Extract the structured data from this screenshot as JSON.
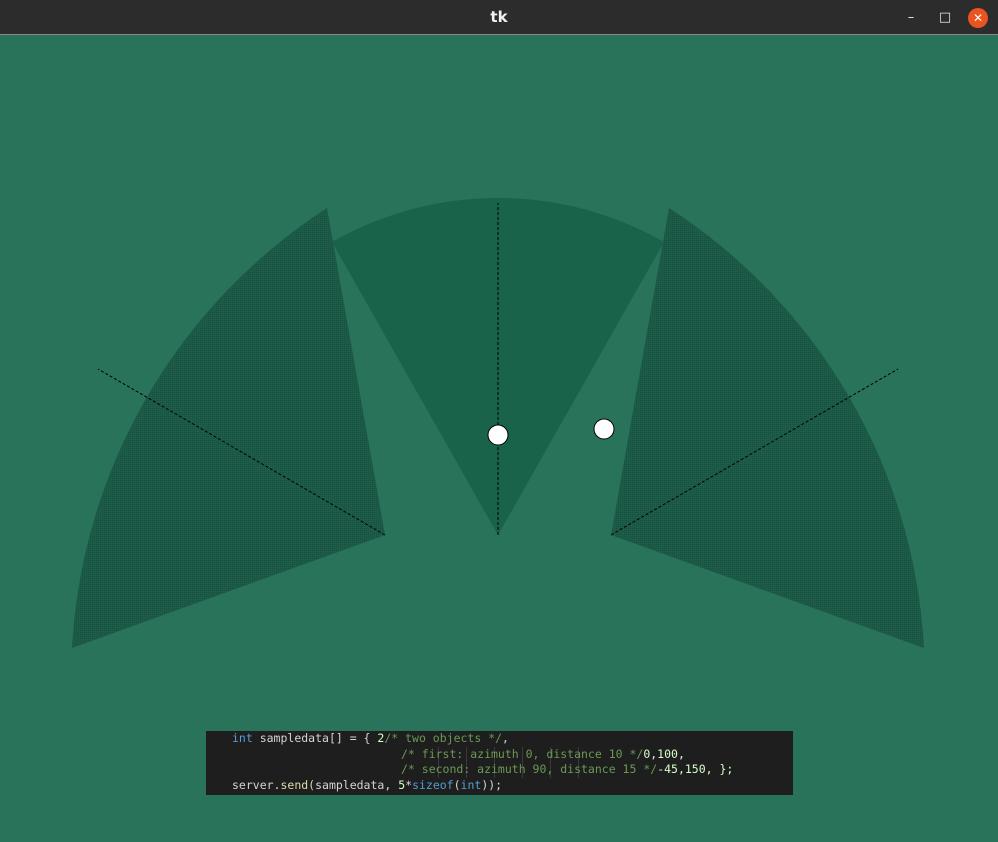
{
  "window": {
    "title": "tk",
    "minimize_glyph": "–",
    "maximize_glyph": "□",
    "close_glyph": "✕"
  },
  "colors": {
    "background": "#28735a",
    "sector_center": "#18634a",
    "sector_side": "#1b5b48",
    "code_background": "#1e1e1e",
    "close_button": "#e95420"
  },
  "code": {
    "line1": {
      "kw": "int",
      "decl": " sampledata[] = { ",
      "num": "2",
      "comment": "/* two objects */",
      "tail": ","
    },
    "line2": {
      "comment": "/* first: azimuth 0, distance 10 */",
      "values": "0,100,"
    },
    "line3": {
      "comment": "/* second: azimuth 90, distance 15 */",
      "values": "-45,150, };"
    },
    "line4": {
      "obj": "server.",
      "fn": "send",
      "args": "(sampledata, ",
      "num": "5",
      "op": "*",
      "kw1": "sizeof",
      "paren": "(",
      "kw2": "int",
      "tail": "));"
    }
  }
}
